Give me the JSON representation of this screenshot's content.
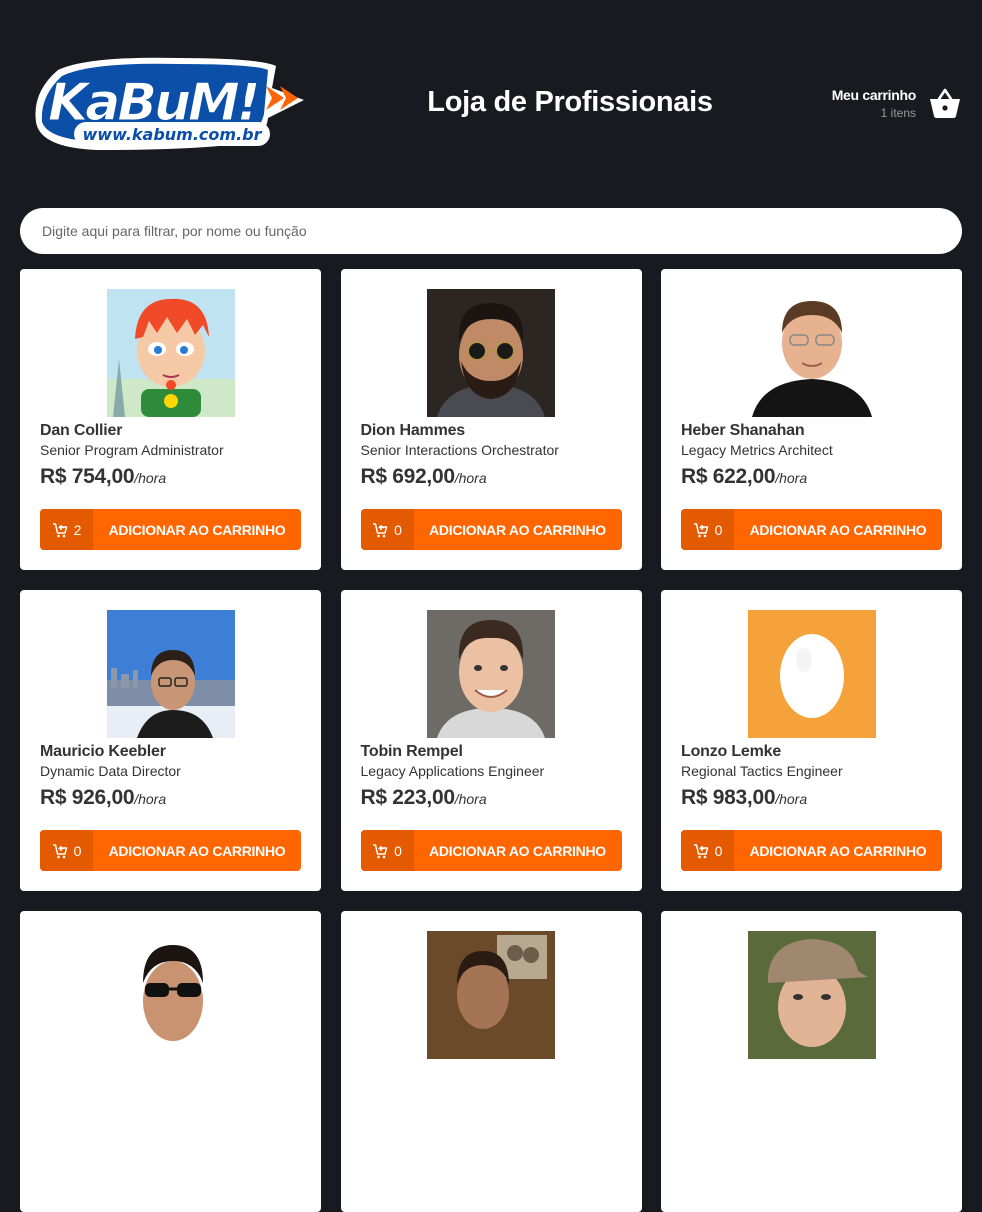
{
  "header": {
    "brand": "KaBuM!",
    "brand_url": "www.kabum.com.br",
    "title": "Loja de Profissionais",
    "cart_label": "Meu carrinho",
    "cart_count": "1 itens"
  },
  "search": {
    "placeholder": "Digite aqui para filtrar, por nome ou função"
  },
  "colors": {
    "background": "#191920",
    "accent": "#ff6500",
    "accent_dark": "#e35a00",
    "brand_blue": "#1560c9"
  },
  "products": [
    {
      "name": "Dan Collier",
      "role": "Senior Program Administrator",
      "price": "R$ 754,00",
      "unit": "/hora",
      "qty": "2",
      "button": "ADICIONAR AO CARRINHO"
    },
    {
      "name": "Dion Hammes",
      "role": "Senior Interactions Orchestrator",
      "price": "R$ 692,00",
      "unit": "/hora",
      "qty": "0",
      "button": "ADICIONAR AO CARRINHO"
    },
    {
      "name": "Heber Shanahan",
      "role": "Legacy Metrics Architect",
      "price": "R$ 622,00",
      "unit": "/hora",
      "qty": "0",
      "button": "ADICIONAR AO CARRINHO"
    },
    {
      "name": "Mauricio Keebler",
      "role": "Dynamic Data Director",
      "price": "R$ 926,00",
      "unit": "/hora",
      "qty": "0",
      "button": "ADICIONAR AO CARRINHO"
    },
    {
      "name": "Tobin Rempel",
      "role": "Legacy Applications Engineer",
      "price": "R$ 223,00",
      "unit": "/hora",
      "qty": "0",
      "button": "ADICIONAR AO CARRINHO"
    },
    {
      "name": "Lonzo Lemke",
      "role": "Regional Tactics Engineer",
      "price": "R$ 983,00",
      "unit": "/hora",
      "qty": "0",
      "button": "ADICIONAR AO CARRINHO"
    },
    {
      "name": "",
      "role": "",
      "price": "",
      "unit": "",
      "qty": "",
      "button": ""
    },
    {
      "name": "",
      "role": "",
      "price": "",
      "unit": "",
      "qty": "",
      "button": ""
    },
    {
      "name": "",
      "role": "",
      "price": "",
      "unit": "",
      "qty": "",
      "button": ""
    }
  ]
}
